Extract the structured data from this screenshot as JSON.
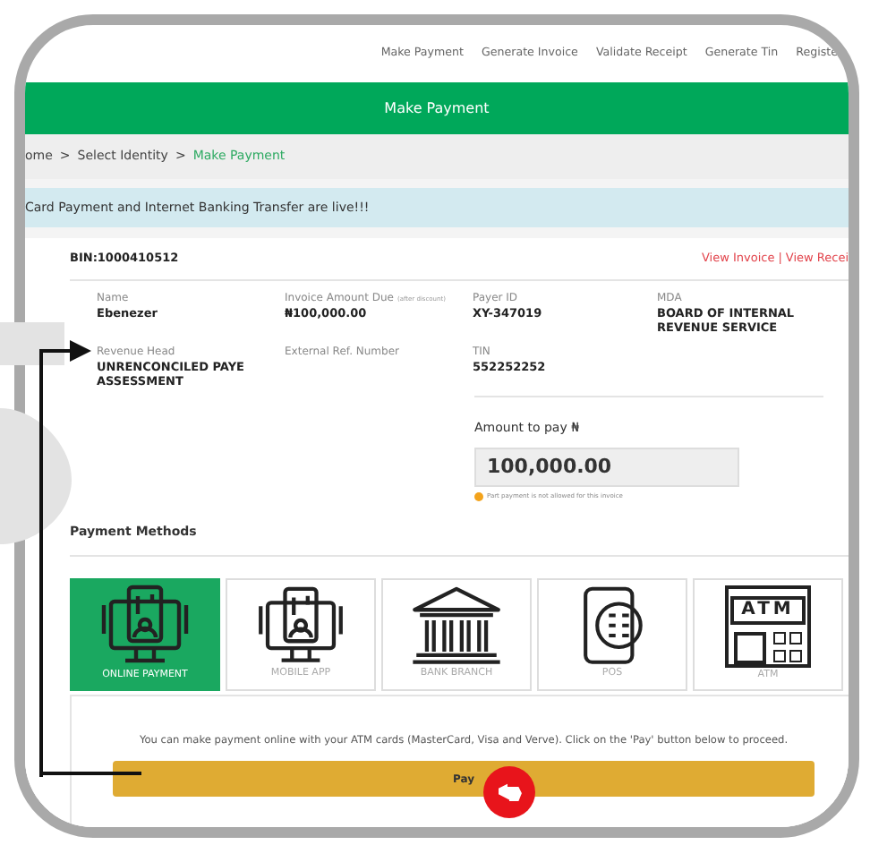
{
  "nav": {
    "links": [
      "Make Payment",
      "Generate Invoice",
      "Validate Receipt",
      "Generate Tin",
      "Registe"
    ]
  },
  "header": {
    "title": "Make Payment"
  },
  "breadcrumb": {
    "items": [
      "ome",
      "Select Identity"
    ],
    "separator": ">",
    "current": "Make Payment"
  },
  "alert": {
    "text": "Card Payment and Internet Banking Transfer are live!!!"
  },
  "invoice": {
    "bin": "BIN:1000410512",
    "links": [
      "View Invoice",
      "View Recei"
    ],
    "link_separator": "|",
    "fields": [
      {
        "label": "Name",
        "value": "Ebenezer"
      },
      {
        "label": "Invoice Amount Due",
        "label_note": "(after discount)",
        "value": "₦100,000.00"
      },
      {
        "label": "Payer ID",
        "value": "XY-347019"
      },
      {
        "label": "MDA",
        "value": "BOARD OF INTERNAL REVENUE SERVICE"
      },
      {
        "label": "Revenue Head",
        "value": "UNRENCONCILED PAYE ASSESSMENT"
      },
      {
        "label": "External Ref. Number"
      },
      {
        "label": "TIN",
        "value": "552252252"
      }
    ],
    "amount": {
      "label": "Amount to pay ₦",
      "value": "100,000.00",
      "note": "Part payment is not allowed for this invoice"
    }
  },
  "payment_methods": {
    "title": "Payment Methods",
    "methods": [
      {
        "kind": "online",
        "label": "ONLINE PAYMENT",
        "selected": true
      },
      {
        "kind": "mobile",
        "label": "MOBILE APP",
        "selected": false
      },
      {
        "kind": "bank",
        "label": "BANK BRANCH",
        "selected": false
      },
      {
        "kind": "pos",
        "label": "POS",
        "selected": false
      },
      {
        "kind": "atm",
        "label": "ATM",
        "icon_text": "ATM",
        "selected": false
      }
    ],
    "description": "You can make payment online with your ATM cards (MasterCard, Visa and Verve). Click on the 'Pay' button below to proceed.",
    "button": "Pay"
  }
}
